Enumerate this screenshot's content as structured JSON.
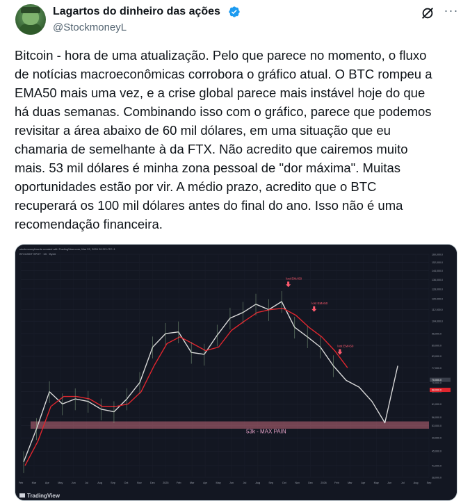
{
  "author": {
    "display_name": "Lagartos do dinheiro das ações",
    "handle": "@StockmoneyL",
    "verified_color": "#1d9bf0"
  },
  "actions": {
    "grok_icon": "grok-icon",
    "more_icon": "more-icon",
    "more_glyph": "···"
  },
  "tweet": {
    "lines": [
      "Bitcoin - hora de uma atualização. Pelo que parece no momento, o fluxo",
      "de notícias macroeconômicas corrobora o gráfico atual. O BTC rompeu a",
      "EMA50 mais uma vez, e a crise global parece mais instável hoje do que",
      "há duas semanas. Combinando isso com o gráfico, parece que podemos",
      "revisitar a área abaixo de 60 mil dólares, em uma situação que eu",
      "chamaria de semelhante à da FTX. Não acredito que cairemos muito",
      "mais. 53 mil dólares é minha zona pessoal de \"dor máxima\". Muitas",
      "oportunidades estão por vir. A médio prazo, acredito que o BTC",
      "recuperará os 100 mil dólares antes do final do ano. Isso não é uma",
      "recomendação financeira."
    ]
  },
  "chart_data": {
    "type": "line",
    "header": "stockmoneylizards created with TradingView.com, Mar 22, 2026 20:32 UTC+1",
    "symbol": "BTCUSDT SPOT · 1D · Bybit",
    "x": [
      "Feb",
      "Mar",
      "Apr",
      "May",
      "Jun",
      "Jul",
      "Aug",
      "Sep",
      "Oct",
      "Nov",
      "Dec",
      "2025",
      "Feb",
      "Mar",
      "Apr",
      "May",
      "Jun",
      "Jul",
      "Aug",
      "Sep",
      "Oct",
      "Nov",
      "Dec",
      "2026",
      "Feb",
      "Mar",
      "Apr",
      "May",
      "Jun",
      "Jul",
      "Aug",
      "Sep"
    ],
    "series": [
      {
        "values": [
          42000,
          52000,
          66000,
          61000,
          63000,
          62000,
          59000,
          58000,
          63000,
          70000,
          88000,
          96000,
          97000,
          85000,
          84000,
          95000,
          106000,
          110000,
          116000,
          112000,
          118000,
          100000,
          94000,
          88000,
          78000,
          71000,
          68000,
          62000,
          54000,
          78000
        ]
      },
      {
        "values": [
          41000,
          48000,
          60000,
          64000,
          64000,
          63000,
          60000,
          60000,
          61000,
          66000,
          78000,
          90000,
          94000,
          90000,
          86000,
          88000,
          98000,
          104000,
          110000,
          112000,
          113000,
          108000,
          100000,
          94000,
          86000,
          77000
        ]
      }
    ],
    "annotations": [
      "lost EMA50",
      "lost EMA50",
      "lost EMA50"
    ],
    "zone_label": "53k - MAX PAIN",
    "y_ticks": [
      "160,000.0",
      "152,000.0",
      "144,000.0",
      "136,000.0",
      "128,000.0",
      "120,000.0",
      "112,000.0",
      "104,000.0",
      "96,000.0",
      "89,000.0",
      "83,000.0",
      "77,000.0",
      "70,000.0",
      "66,000.0",
      "61,000.0",
      "56,000.0",
      "53,000.0",
      "49,000.0",
      "45,000.0",
      "41,000.0",
      "38,000.0"
    ],
    "price_labels": [
      "70,000.0",
      "68,000.0"
    ],
    "footer": "TradingView",
    "colors": {
      "bg": "#131722",
      "price": "#d9d9d9",
      "ema": "#e0262e",
      "zone": "#c46a7a",
      "zone_label": "#e6a3c8",
      "annotation": "#ff5a6e"
    }
  }
}
